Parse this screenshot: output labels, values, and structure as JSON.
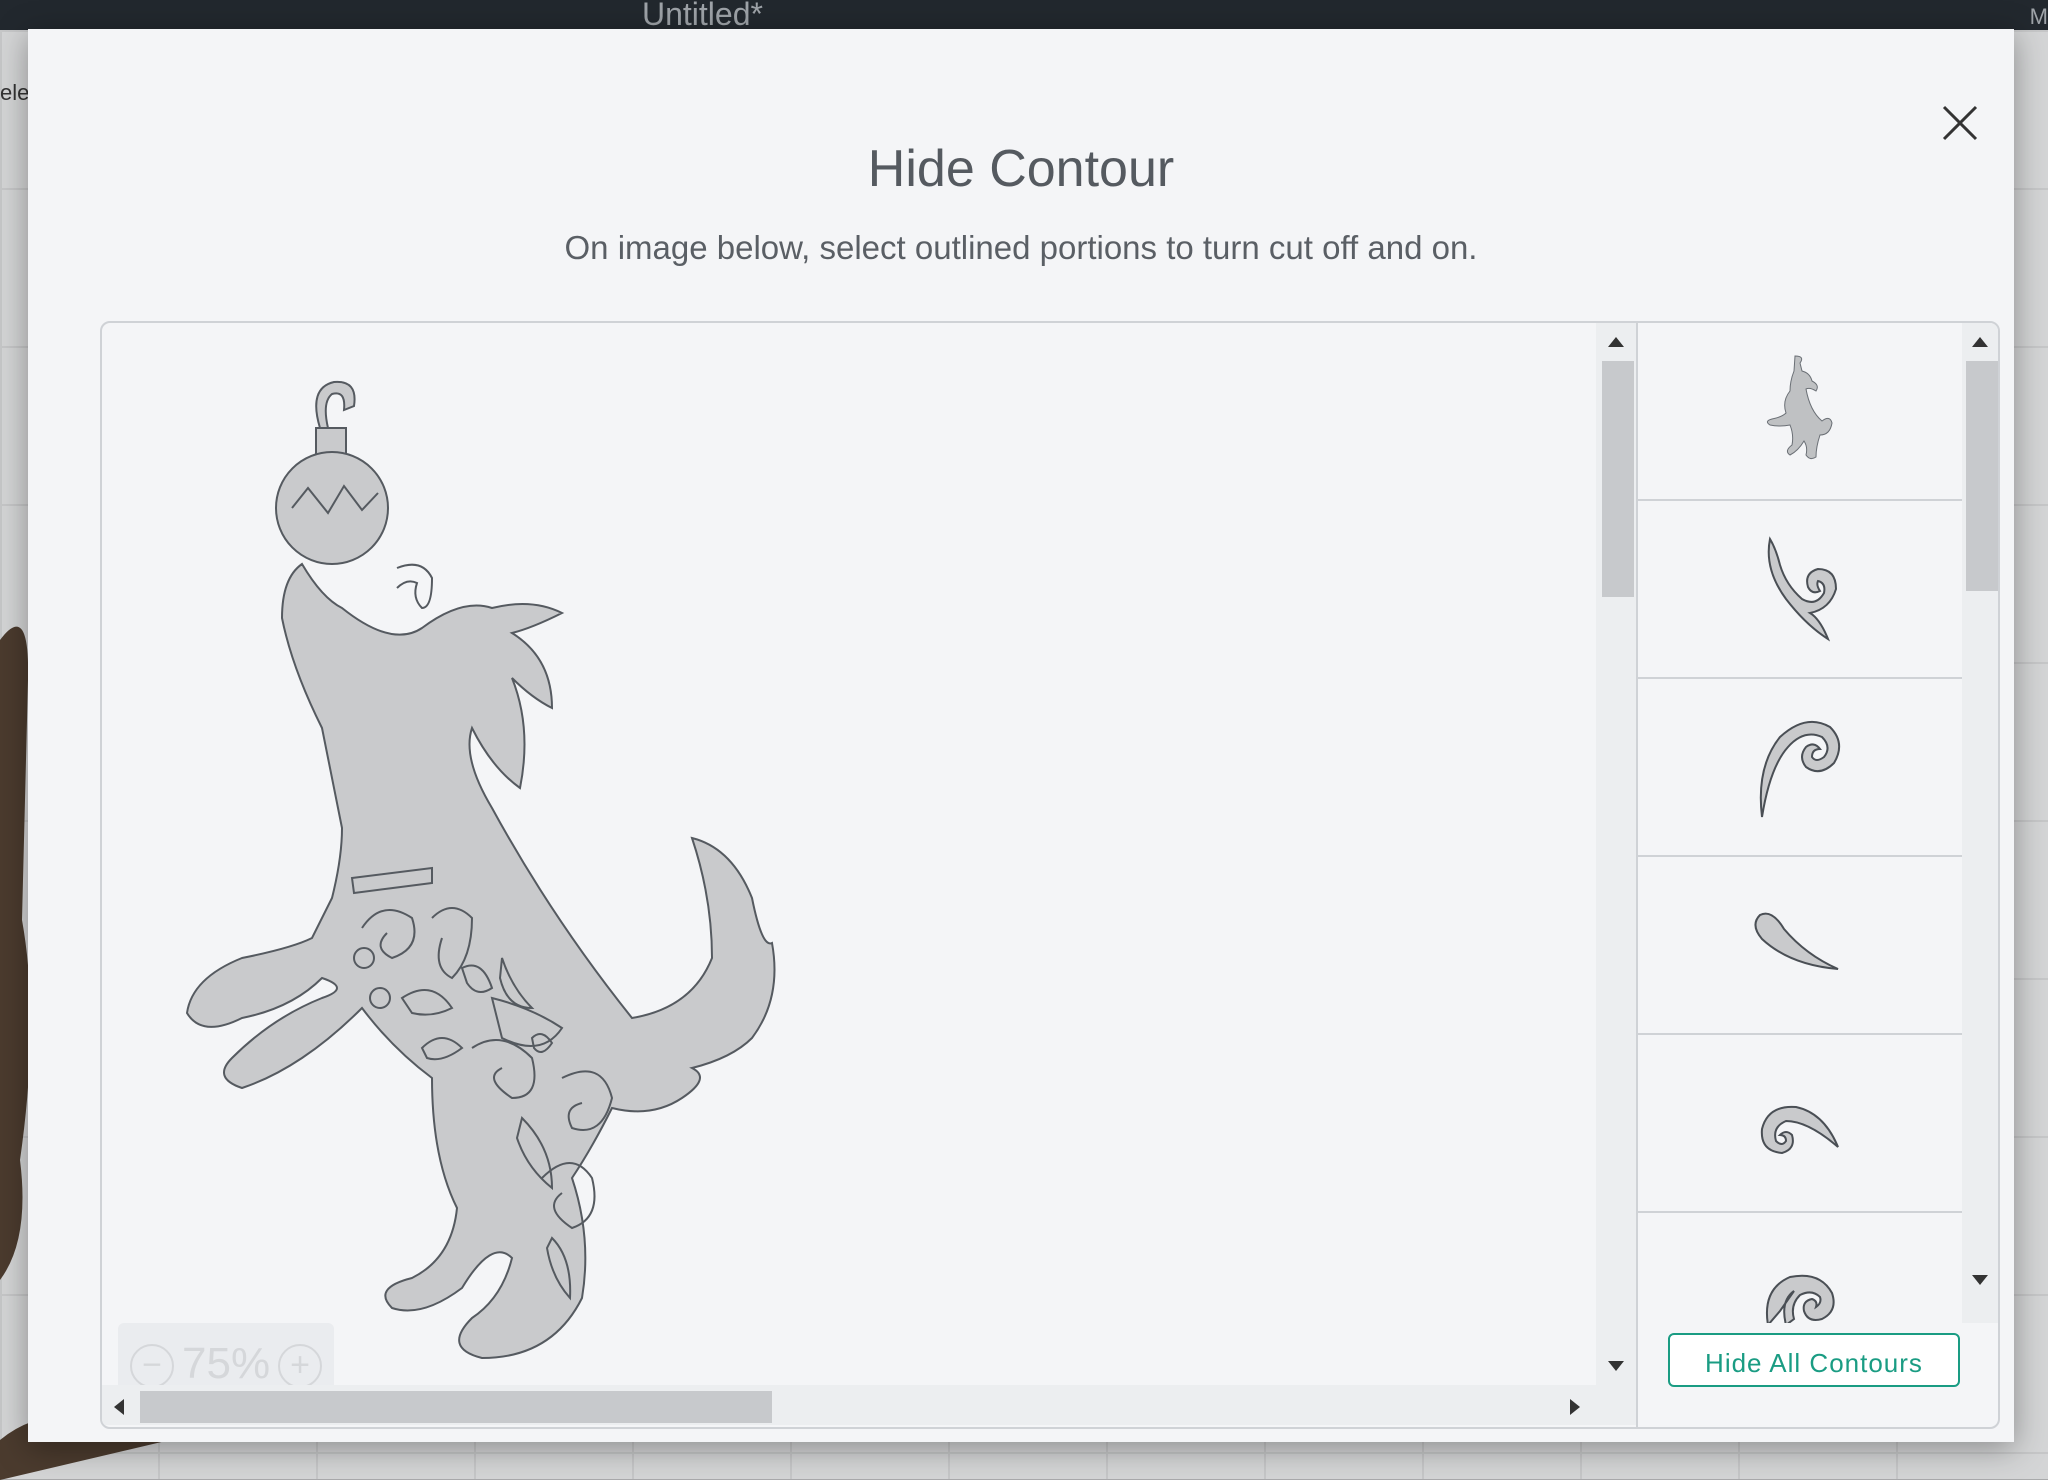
{
  "background": {
    "document_title": "Untitled*",
    "left_fragment": "ele",
    "right_fragment": "M"
  },
  "modal": {
    "title": "Hide Contour",
    "subtitle": "On image below, select outlined portions to turn cut off and on.",
    "zoom": {
      "label": "75%",
      "minus": "−",
      "plus": "+"
    },
    "hide_all_label": "Hide All Contours",
    "contour_list": [
      {
        "icon": "dog-silhouette-icon"
      },
      {
        "icon": "swirl-leaf-icon"
      },
      {
        "icon": "swirl-curl-icon"
      },
      {
        "icon": "teardrop-icon"
      },
      {
        "icon": "curl-hook-icon"
      },
      {
        "icon": "spiral-icon"
      }
    ]
  },
  "colors": {
    "accent": "#1a9c83",
    "shape_fill": "#c9cacc",
    "shape_stroke": "#555a60"
  }
}
